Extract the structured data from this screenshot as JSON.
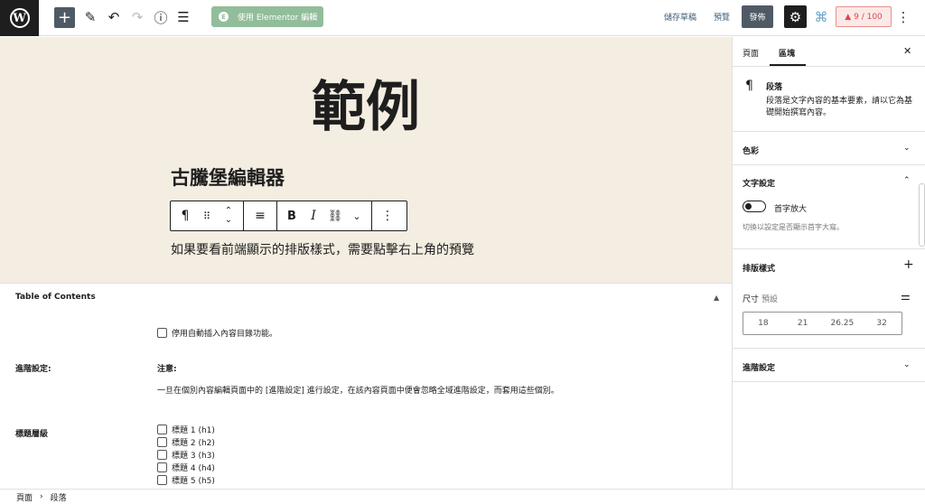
{
  "topbar": {
    "elementor_label": "使用 Elementor 編輯",
    "save_draft": "儲存草稿",
    "preview": "預覽",
    "publish": "發佈",
    "seo_score": "9 / 100",
    "seo_color": "#d84a4a"
  },
  "editor": {
    "title": "範例",
    "heading": "古騰堡編輯器",
    "paragraph": "如果要看前端顯示的排版樣式，需要點擊右上角的預覽"
  },
  "toc": {
    "header": "Table of Contents",
    "disable_auto_insert": "停用自動插入內容目錄功能。",
    "advanced_label": "進階設定:",
    "notice_title": "注意:",
    "notice_text": "一旦在個別內容編輯頁面中的 [進階設定] 進行設定，在該內容頁面中便會忽略全域進階設定，而套用這些個別。",
    "heading_levels_label": "標題層級",
    "heading_levels": [
      "標題 1 (h1)",
      "標題 2 (h2)",
      "標題 3 (h3)",
      "標題 4 (h4)",
      "標題 5 (h5)"
    ]
  },
  "breadcrumb": {
    "root": "頁面",
    "current": "段落"
  },
  "sidebar": {
    "tab_page": "頁面",
    "tab_block": "區塊",
    "block_name": "段落",
    "block_desc": "段落是文字內容的基本要素，請以它為基礎開始撰寫內容。",
    "color_panel": "色彩",
    "text_settings_panel": "文字設定",
    "drop_cap_label": "首字放大",
    "drop_cap_help": "切換以設定是否顯示首字大寫。",
    "typography_panel": "排版樣式",
    "size_label": "尺寸",
    "size_default": "預設",
    "size_options": [
      "18",
      "21",
      "26.25",
      "32"
    ],
    "advanced_panel": "進階設定"
  }
}
